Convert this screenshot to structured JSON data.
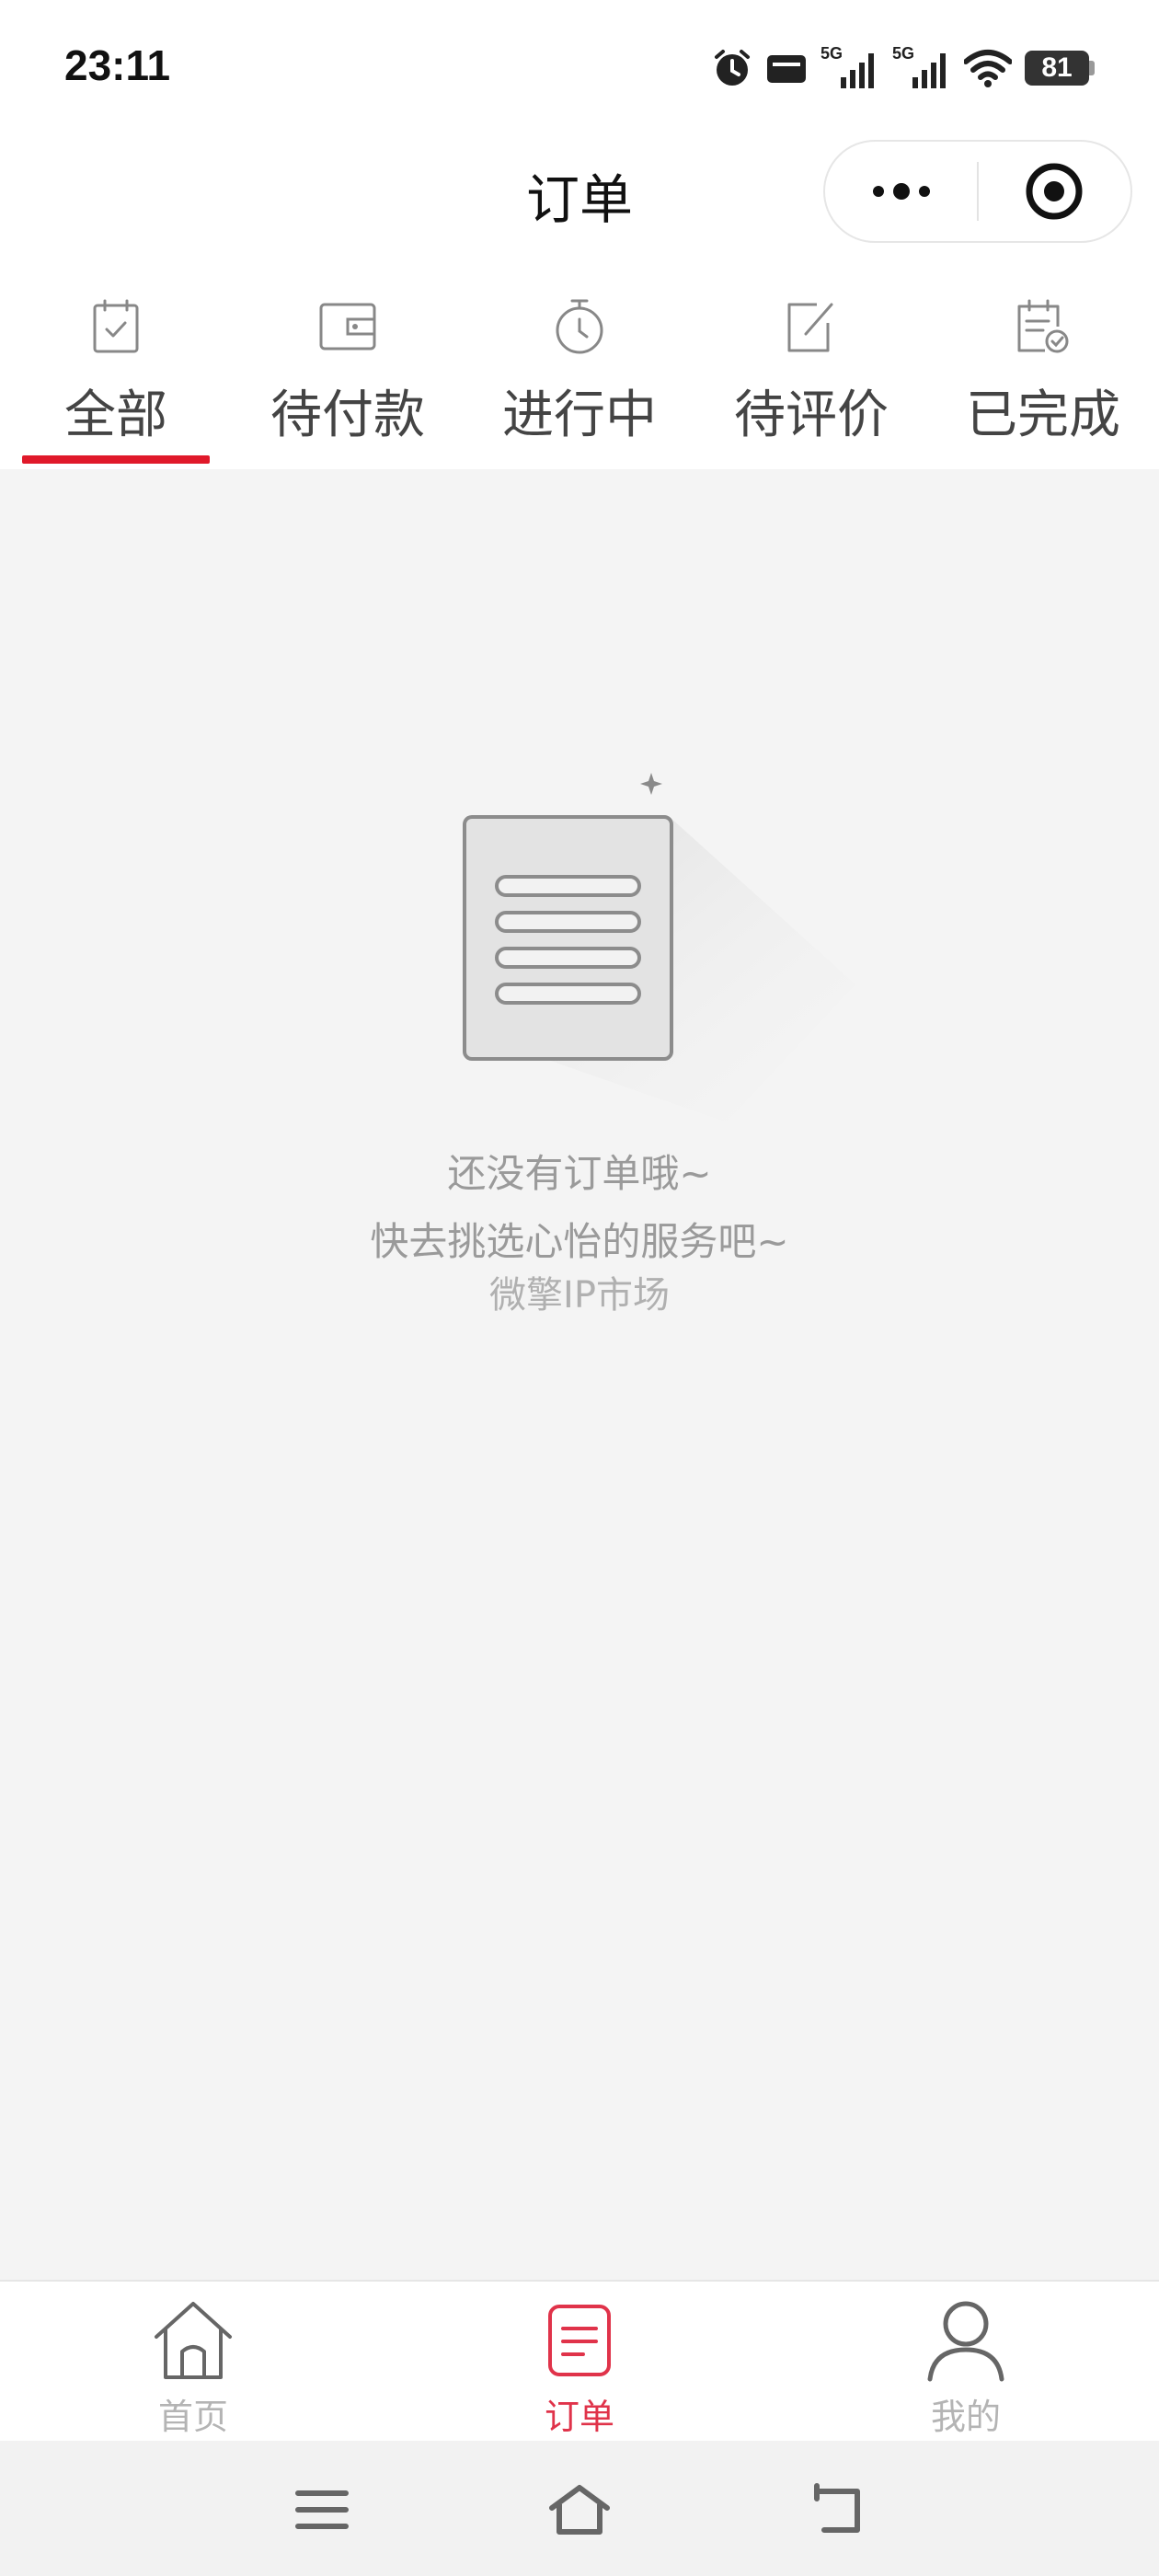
{
  "status_bar": {
    "time": "23:11",
    "network_label_1": "5G",
    "network_label_2": "5G",
    "battery": "81",
    "icons": [
      "alarm-icon",
      "sim-card-icon",
      "signal-icon",
      "signal-icon",
      "wifi-icon",
      "battery-icon"
    ]
  },
  "nav": {
    "title": "订单",
    "capsule_icons": [
      "more-dots-icon",
      "close-target-icon"
    ]
  },
  "tabs": [
    {
      "label": "全部",
      "icon": "clipboard-check-icon",
      "active": true
    },
    {
      "label": "待付款",
      "icon": "wallet-icon",
      "active": false
    },
    {
      "label": "进行中",
      "icon": "stopwatch-icon",
      "active": false
    },
    {
      "label": "待评价",
      "icon": "edit-icon",
      "active": false
    },
    {
      "label": "已完成",
      "icon": "clipboard-done-icon",
      "active": false
    }
  ],
  "empty_state": {
    "line1": "还没有订单哦~",
    "line2": "快去挑选心怡的服务吧~",
    "line3": "微擎IP市场",
    "icon": "empty-document-icon"
  },
  "bottom_nav": [
    {
      "label": "首页",
      "icon": "home-icon",
      "active": false
    },
    {
      "label": "订单",
      "icon": "order-icon",
      "active": true
    },
    {
      "label": "我的",
      "icon": "user-icon",
      "active": false
    }
  ],
  "system_nav": [
    "menu-icon",
    "home-outline-icon",
    "back-icon"
  ],
  "colors": {
    "accent": "#e0192a",
    "active_label": "#e0334a",
    "background": "#f4f4f4",
    "muted_text": "#9a9a9a"
  }
}
